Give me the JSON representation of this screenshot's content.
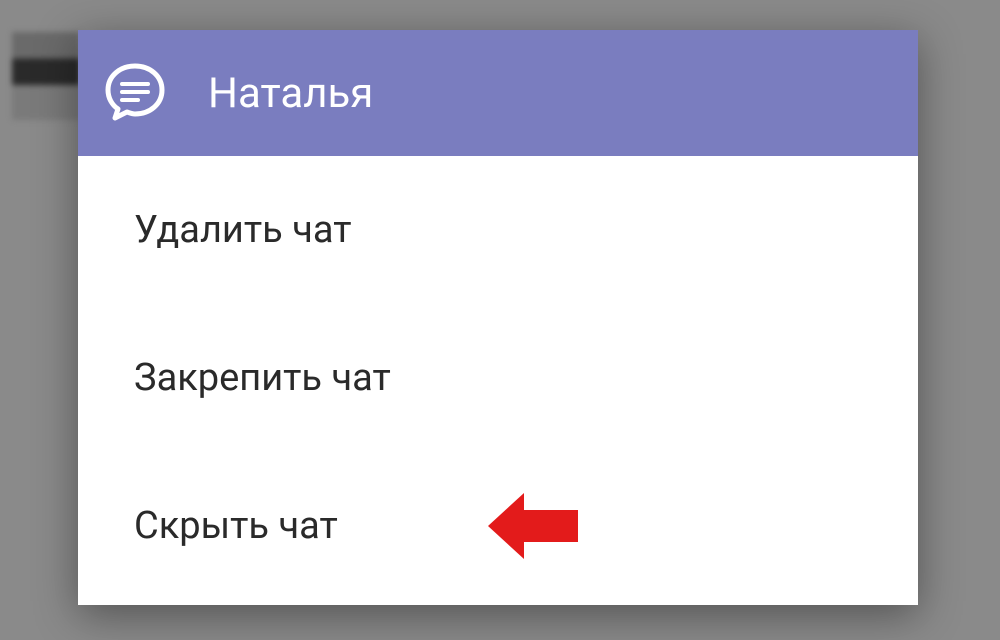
{
  "header": {
    "title": "Наталья",
    "icon": "chat-bubble-icon"
  },
  "menu": {
    "items": [
      {
        "label": "Удалить чат",
        "highlighted": false
      },
      {
        "label": "Закрепить чат",
        "highlighted": false
      },
      {
        "label": "Скрыть чат",
        "highlighted": true
      }
    ]
  },
  "colors": {
    "header_bg": "#7a7dbf",
    "dialog_bg": "#ffffff",
    "backdrop": "#8a8a8a",
    "arrow": "#e31b1b",
    "text_dark": "#2a2a2a",
    "text_light": "#ffffff"
  }
}
